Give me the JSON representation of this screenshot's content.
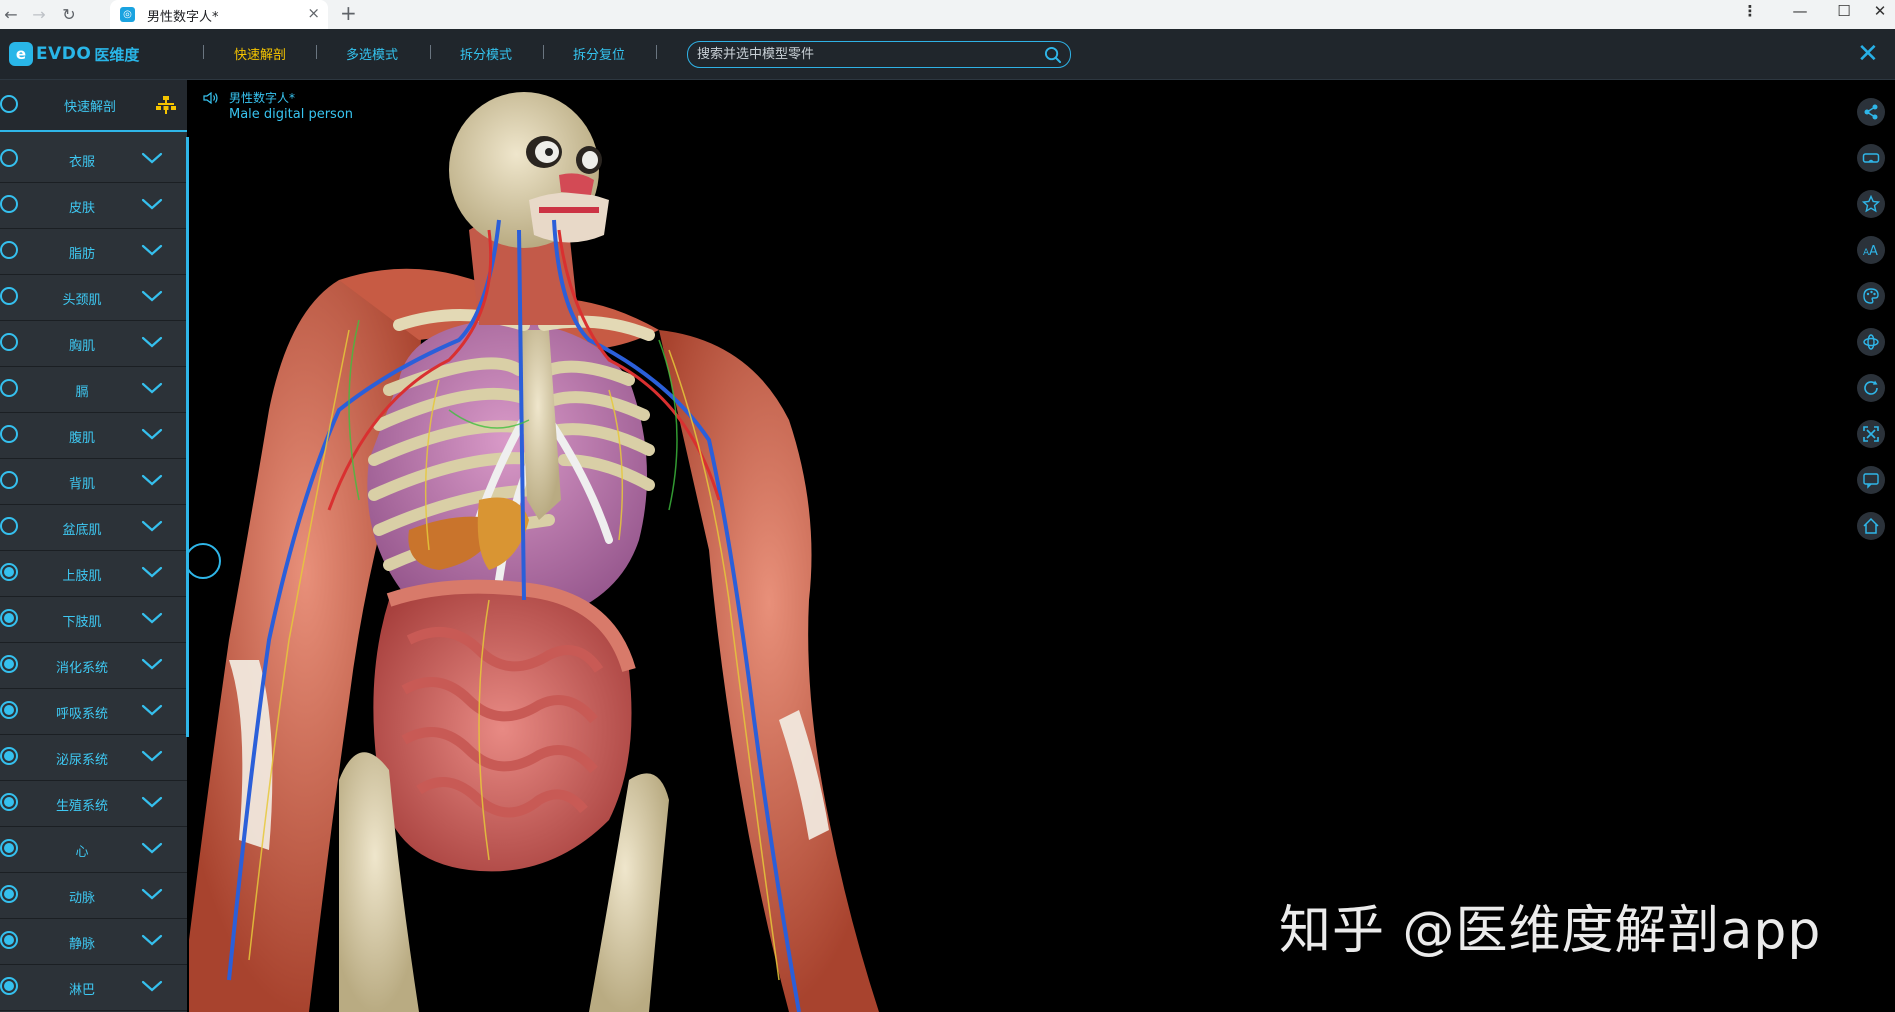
{
  "browser": {
    "tab_title": "男性数字人*",
    "tab_icon_glyph": "◎"
  },
  "app": {
    "brand": "EVDO",
    "brand_cn": "医维度",
    "modes": [
      {
        "label": "快速解剖",
        "active": true
      },
      {
        "label": "多选模式",
        "active": false
      },
      {
        "label": "拆分模式",
        "active": false
      },
      {
        "label": "拆分复位",
        "active": false
      }
    ],
    "search_placeholder": "搜索并选中模型零件"
  },
  "sidebar": {
    "header_label": "快速解剖",
    "layers": [
      {
        "label": "衣服",
        "checked": false
      },
      {
        "label": "皮肤",
        "checked": false
      },
      {
        "label": "脂肪",
        "checked": false
      },
      {
        "label": "头颈肌",
        "checked": false
      },
      {
        "label": "胸肌",
        "checked": false
      },
      {
        "label": "膈",
        "checked": false
      },
      {
        "label": "腹肌",
        "checked": false
      },
      {
        "label": "背肌",
        "checked": false
      },
      {
        "label": "盆底肌",
        "checked": false
      },
      {
        "label": "上肢肌",
        "checked": true
      },
      {
        "label": "下肢肌",
        "checked": true
      },
      {
        "label": "消化系统",
        "checked": true
      },
      {
        "label": "呼吸系统",
        "checked": true
      },
      {
        "label": "泌尿系统",
        "checked": true
      },
      {
        "label": "生殖系统",
        "checked": true
      },
      {
        "label": "心",
        "checked": true
      },
      {
        "label": "动脉",
        "checked": true
      },
      {
        "label": "静脉",
        "checked": true
      },
      {
        "label": "淋巴",
        "checked": true
      }
    ]
  },
  "viewport": {
    "model_name_cn": "男性数字人*",
    "model_name_en": "Male digital person",
    "watermark": "知乎 @医维度解剖app"
  },
  "colors": {
    "accent": "#2fb6e8",
    "active_mode": "#f5c400",
    "toolbar_bg": "#20262c",
    "sidebar_bg": "#2c3238"
  },
  "tools": [
    "share-icon",
    "vr-glasses-icon",
    "star-icon",
    "font-size-icon",
    "palette-icon",
    "rotate-3d-icon",
    "refresh-icon",
    "fullscreen-icon",
    "comment-icon",
    "home-icon"
  ]
}
